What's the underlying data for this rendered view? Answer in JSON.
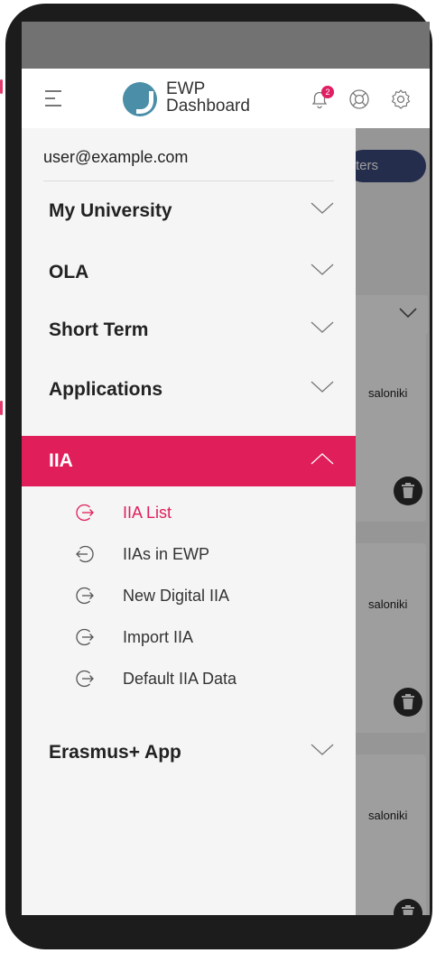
{
  "header": {
    "logo_line1": "EWP",
    "logo_line2": "Dashboard",
    "notification_count": "2"
  },
  "drawer": {
    "user_email": "user@example.com",
    "menu": [
      {
        "label": "My University",
        "expanded": false
      },
      {
        "label": "OLA",
        "expanded": false
      },
      {
        "label": "Short Term",
        "expanded": false
      },
      {
        "label": "Applications",
        "expanded": false
      },
      {
        "label": "IIA",
        "expanded": true,
        "active": true
      },
      {
        "label": "Erasmus+ App",
        "expanded": false
      }
    ],
    "iia_submenu": [
      {
        "label": "IIA List",
        "active": true,
        "icon": "arrow-right-circle-icon"
      },
      {
        "label": "IIAs in EWP",
        "active": false,
        "icon": "arrow-left-circle-icon"
      },
      {
        "label": "New Digital IIA",
        "active": false,
        "icon": "arrow-right-circle-icon"
      },
      {
        "label": "Import IIA",
        "active": false,
        "icon": "arrow-right-circle-icon"
      },
      {
        "label": "Default IIA Data",
        "active": false,
        "icon": "arrow-right-circle-icon"
      }
    ]
  },
  "background": {
    "filter_button_partial": "ters",
    "card_text_partial": [
      "saloniki",
      "saloniki",
      "saloniki"
    ]
  },
  "colors": {
    "accent": "#e01e5a",
    "logo": "#4a8ea8",
    "badge": "#e01e63",
    "pill": "#3b4a7a"
  }
}
